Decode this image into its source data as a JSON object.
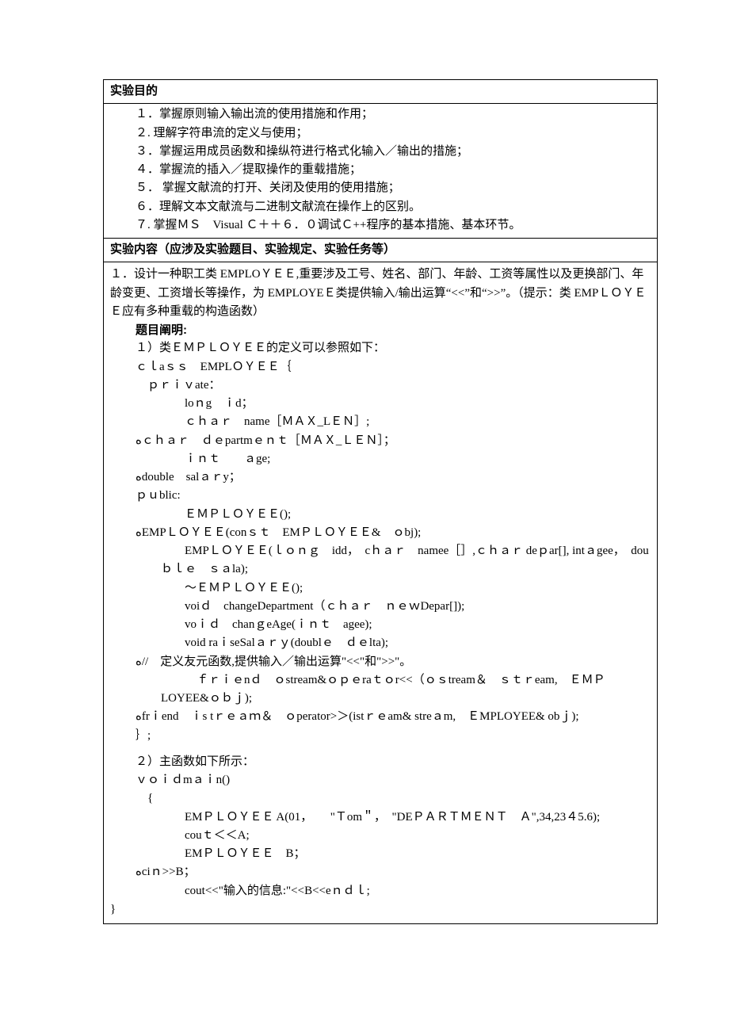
{
  "sec1": {
    "title": "实验目的",
    "items": [
      "１．掌握原则输入输出流的使用措施和作用；",
      "２. 理解字符串流的定义与使用；",
      "３．掌握运用成员函数和操纵符进行格式化输入／输出的措施；",
      "４．掌握流的插入／提取操作的重载措施；",
      "５． 掌握文献流的打开、关闭及使用的使用措施；",
      "６．理解文本文献流与二进制文献流在操作上的区别。",
      "７. 掌握ＭＳ　Visual Ｃ＋＋６．０调试Ｃ++程序的基本措施、基本环节。"
    ]
  },
  "sec2": {
    "title": "实验内容（应涉及实验题目、实验规定、实验任务等）",
    "p1_a": "１．设计一种职工类 EMPLOＹＥＥ,重要涉及工号、姓名、部门、年龄、工资等属性以及更换部门、年龄变更、工资增长等操作，为 EMPLOYEＥ类提供输入/输出运算“<<”和“>>”。（提示：类 EMPＬＯＹＥＥ应有多种重载的构造函数）",
    "label_desc": "题目阐明:",
    "l1": "１）类ＥＭＰＬＯＹＥＥ的定义可以参照如下：",
    "code1": [
      "ｃｌaｓｓ　EMPLＯＹＥＥ｛",
      "　ｐｒｉｖate：",
      "　　loｎg　ｉd；",
      "　　ｃｈａｒ　name［ＭＡＸ_LＥＮ］;",
      "ﻩｃｈａｒ　ｄｅpartmｅｎｔ［ＭＡＸ_ＬＥＮ］；",
      "　　ｉｎｔ　　ａge;",
      "ﻩdouble　salａｒy；",
      "ｐｕblic:",
      "　　ＥＭＰＬＯＹＥＥ();",
      "ﻩEMPＬＯＹＥＥ(conｓｔ　EMＰＬＯＹＥＥ&　ｏbj);",
      "　　EMPＬＯＹＥＥ(ｌｏｎｇ　idd，　cｈａｒ　namee［］,ｃｈａｒ deｐar[], intａgee，　douｂｌｅ　ｓａla);",
      "　　～ＥＭＰＬＯＹＥＥ();",
      "　　voiｄ　changeDepartment（ｃｈａｒ　ｎｅｗDepar[]);",
      "　　voｉｄ　chanｇeAge(ｉｎｔ　agee);",
      "　　void raｉseSalａｒｙ(doublｅ　ｄｅlta);",
      "ﻩ//　定义友元函数,提供输入／输出运算\"<<\"和\">>\"。",
      "　　　ｆｒｉｅnｄ　ｏstream&ｏｐｅraｔｏr<<（ｏｓtream＆　ｓｔｒeam,　ＥＭＰLOYEE&ｏｂｊ);",
      "ﻩfrｉend　ｉs tｒｅａｍ＆　ｏperator>＞(istｒｅam& streａm,　ＥMPLOYEE& obｊ);",
      "｝;"
    ],
    "l2": "２）主函数如下所示：",
    "code2": [
      "ｖｏｉｄmａｉn()",
      "　{",
      "　　EMＰＬＯＹＥＥ A(01，　　\"Ｔom＂，　\"DEＰＡＲＴＭＥＮＴ　Ａ\",34,23４5.6);",
      "　　couｔ＜＜A;",
      "　　EMＰＬＯＹＥＥ　B；",
      "ﻩciｎ>>B；",
      "　　cout<<\"输入的信息:\"<<B<<eｎｄｌ;"
    ],
    "closing": "}"
  }
}
